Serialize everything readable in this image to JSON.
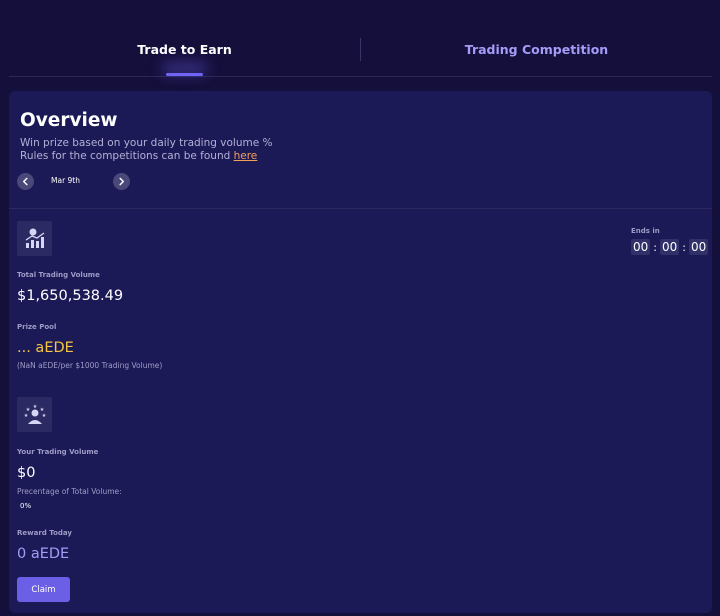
{
  "tabs": [
    {
      "label": "Trade to Earn",
      "active": true
    },
    {
      "label": "Trading Competition",
      "active": false
    }
  ],
  "overview": {
    "title": "Overview",
    "description_line1": "Win prize based on your daily trading volume %",
    "description_line2_prefix": "Rules for the competitions can be found ",
    "rules_link": "here",
    "date": "Mar 9th"
  },
  "stats": {
    "ends_in_label": "Ends in",
    "countdown": {
      "hours": "00",
      "minutes": "00",
      "seconds": "00"
    },
    "total_volume_label": "Total Trading Volume",
    "total_volume": "$1,650,538.49",
    "prize_pool_label": "Prize Pool",
    "prize_pool": "... aEDE",
    "prize_rate": "(NaN aEDE/per $1000 Trading Volume)",
    "your_volume_label": "Your Trading Volume",
    "your_volume": "$0",
    "percentage_label": "Precentage of Total Volume:",
    "percentage": "0%",
    "reward_label": "Reward Today",
    "reward": "0 aEDE",
    "claim_label": "Claim"
  },
  "icons": {
    "chart_icon": "chart-user-icon",
    "user_icon": "star-user-icon",
    "prev": "chevron-left-icon",
    "next": "chevron-right-icon"
  },
  "colors": {
    "background": "#150f3b",
    "card": "#1c1a56",
    "accent": "#6b5fe6",
    "prize": "#f5c542",
    "link": "#f4a05b",
    "inactive_tab": "#a49cf8"
  }
}
